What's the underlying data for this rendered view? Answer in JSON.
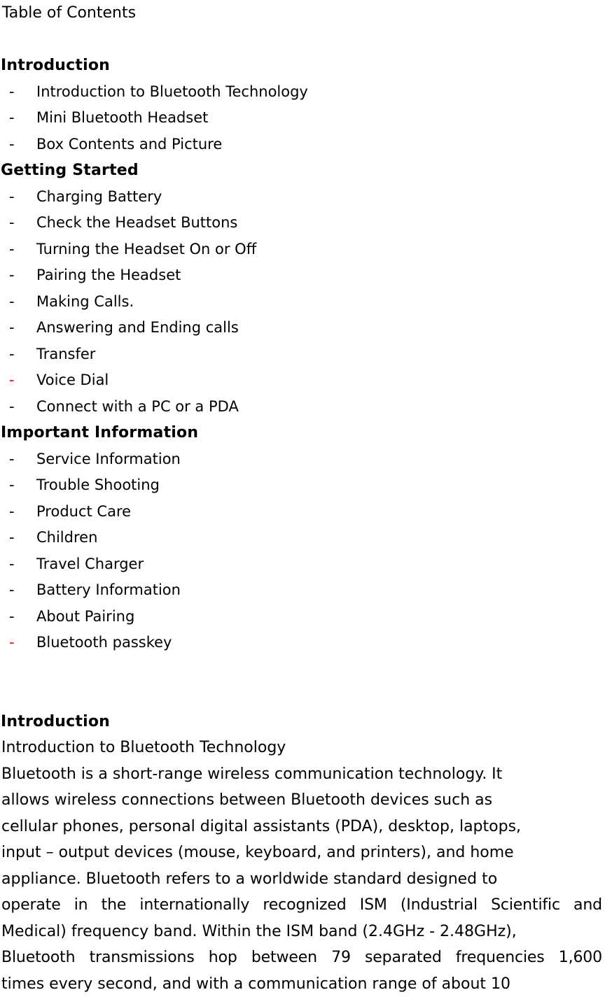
{
  "document": {
    "title": "Table of Contents",
    "toc": {
      "sections": [
        {
          "heading": "Introduction",
          "items": [
            {
              "dash": "-",
              "dash_color": "#000000",
              "label": "Introduction to Bluetooth Technology"
            },
            {
              "dash": "-",
              "dash_color": "#000000",
              "label": "Mini Bluetooth Headset"
            },
            {
              "dash": "-",
              "dash_color": "#000000",
              "label": "Box Contents and Picture"
            }
          ]
        },
        {
          "heading": "Getting Started",
          "items": [
            {
              "dash": "-",
              "dash_color": "#000000",
              "label": "Charging Battery"
            },
            {
              "dash": "-",
              "dash_color": "#000000",
              "label": "Check the Headset Buttons"
            },
            {
              "dash": "-",
              "dash_color": "#000000",
              "label": "Turning the Headset On or Off"
            },
            {
              "dash": "-",
              "dash_color": "#000000",
              "label": "Pairing the Headset"
            },
            {
              "dash": "-",
              "dash_color": "#000000",
              "label": "Making Calls."
            },
            {
              "dash": "-",
              "dash_color": "#000000",
              "label": "Answering and Ending calls"
            },
            {
              "dash": "-",
              "dash_color": "#000000",
              "label": "Transfer"
            },
            {
              "dash": "-",
              "dash_color": "#ee0000",
              "label": "Voice Dial"
            },
            {
              "dash": "-",
              "dash_color": "#000000",
              "label": "Connect with a PC or a PDA"
            }
          ]
        },
        {
          "heading": "Important Information",
          "items": [
            {
              "dash": "-",
              "dash_color": "#000000",
              "label": "Service Information"
            },
            {
              "dash": "-",
              "dash_color": "#000000",
              "label": "Trouble Shooting"
            },
            {
              "dash": "-",
              "dash_color": "#000000",
              "label": "Product Care"
            },
            {
              "dash": "-",
              "dash_color": "#000000",
              "label": "Children"
            },
            {
              "dash": "-",
              "dash_color": "#000000",
              "label": "Travel Charger"
            },
            {
              "dash": "-",
              "dash_color": "#000000",
              "label": "Battery Information"
            },
            {
              "dash": "-",
              "dash_color": "#000000",
              "label": "About Pairing"
            },
            {
              "dash": "-",
              "dash_color": "#ee0000",
              "label": "Bluetooth passkey"
            }
          ]
        }
      ]
    },
    "body": {
      "heading": "Introduction",
      "subheading": "Introduction to Bluetooth Technology",
      "paragraph_lines": [
        {
          "text": "Bluetooth is a short-range wireless communication technology. It",
          "justify": false
        },
        {
          "text": "allows wireless connections between Bluetooth devices such as",
          "justify": false
        },
        {
          "text": "cellular phones, personal digital assistants (PDA), desktop, laptops,",
          "justify": false
        },
        {
          "text": "input – output devices (mouse, keyboard, and printers), and home",
          "justify": false
        },
        {
          "text": "appliance. Bluetooth refers to a worldwide standard designed to",
          "justify": false
        },
        {
          "text": "operate in the internationally recognized ISM (Industrial Scientific and",
          "justify": true
        },
        {
          "text": "Medical) frequency band. Within the ISM band (2.4GHz - 2.48GHz),",
          "justify": false
        },
        {
          "text": "Bluetooth transmissions hop between 79 separated frequencies 1,600",
          "justify": true
        },
        {
          "text": "times every second, and with a communication range of about 10",
          "justify": false
        }
      ]
    }
  }
}
